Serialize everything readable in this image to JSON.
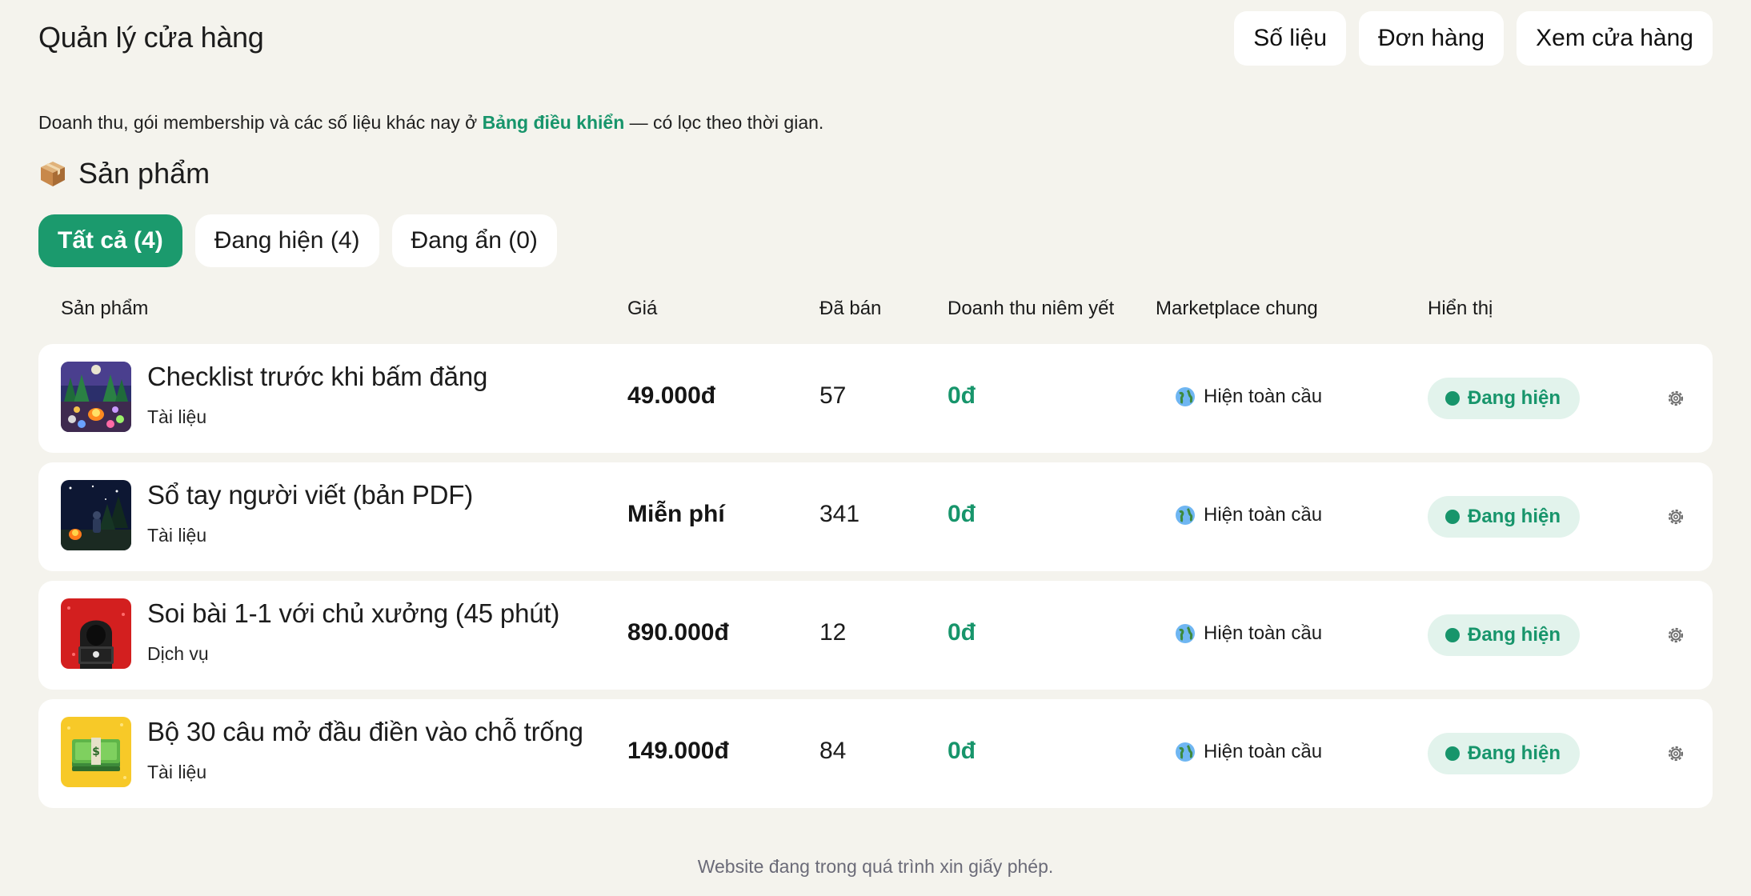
{
  "header": {
    "title": "Quản lý cửa hàng",
    "actions": [
      "Số liệu",
      "Đơn hàng",
      "Xem cửa hàng"
    ]
  },
  "intro": {
    "before": "Doanh thu, gói membership và các số liệu khác nay ở ",
    "link": "Bảng điều khiển",
    "after": " — có lọc theo thời gian."
  },
  "section": {
    "icon": "package-icon",
    "title": "Sản phẩm"
  },
  "filters": [
    "Tất cả (4)",
    "Đang hiện (4)",
    "Đang ẩn (0)"
  ],
  "table": {
    "headers": [
      "Sản phẩm",
      "Giá",
      "Đã bán",
      "Doanh thu niêm yết",
      "Marketplace chung",
      "Hiển thị"
    ],
    "rows": [
      {
        "name": "Checklist trước khi bấm đăng",
        "category": "Tài liệu",
        "price": "49.000đ",
        "sold": "57",
        "revenue": "0đ",
        "marketplace": "Hiện toàn cầu",
        "status": "Đang hiện",
        "thumb": "forest-campfire-thumbnail"
      },
      {
        "name": "Sổ tay người viết (bản PDF)",
        "category": "Tài liệu",
        "price": "Miễn phí",
        "sold": "341",
        "revenue": "0đ",
        "marketplace": "Hiện toàn cầu",
        "status": "Đang hiện",
        "thumb": "night-camp-thumbnail"
      },
      {
        "name": "Soi bài 1-1 với chủ xưởng (45 phút)",
        "category": "Dịch vụ",
        "price": "890.000đ",
        "sold": "12",
        "revenue": "0đ",
        "marketplace": "Hiện toàn cầu",
        "status": "Đang hiện",
        "thumb": "hooded-hacker-thumbnail"
      },
      {
        "name": "Bộ 30 câu mở đầu điền vào chỗ trống",
        "category": "Tài liệu",
        "price": "149.000đ",
        "sold": "84",
        "revenue": "0đ",
        "marketplace": "Hiện toàn cầu",
        "status": "Đang hiện",
        "thumb": "money-stack-thumbnail"
      }
    ]
  },
  "footer": "Website đang trong quá trình xin giấy phép.",
  "colors": {
    "background": "#f4f3ed",
    "accent": "#1b9a6d",
    "badge_bg": "#e2f3ec",
    "card": "#ffffff"
  }
}
